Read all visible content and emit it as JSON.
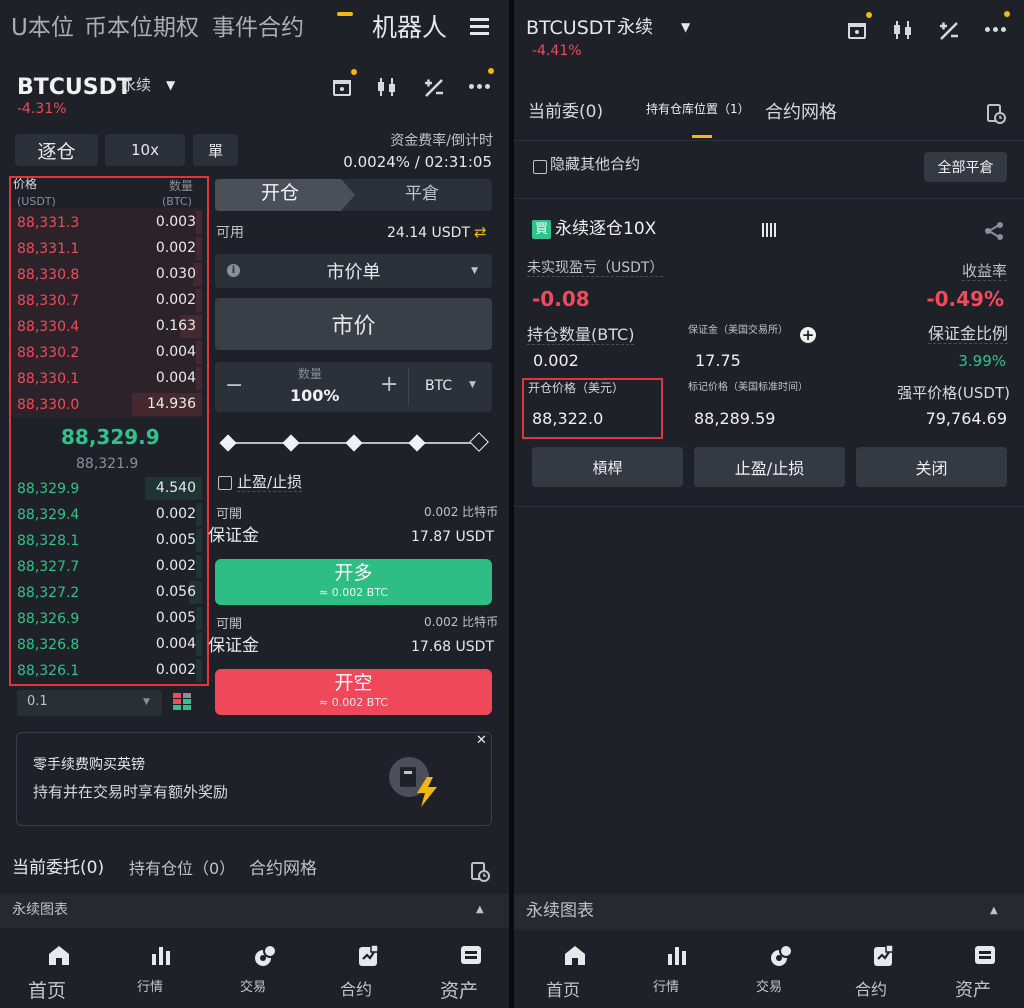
{
  "left": {
    "top_tabs": [
      "U本位",
      "币本位期权",
      "事件合约",
      "机器人"
    ],
    "symbol": "BTCUSDT",
    "contract_type": "永续",
    "change": "-4.31%",
    "margin_mode": "逐仓",
    "leverage": "10x",
    "position_mode": "單",
    "funding_label": "资金费率/倒计时",
    "funding_value": "0.0024% / 02:31:05",
    "ob_price_label": "价格",
    "ob_price_unit": "(USDT)",
    "ob_qty_label": "数量",
    "ob_qty_unit": "(BTC)",
    "asks": [
      {
        "price": "88,331.3",
        "qty": "0.003"
      },
      {
        "price": "88,331.1",
        "qty": "0.002"
      },
      {
        "price": "88,330.8",
        "qty": "0.030"
      },
      {
        "price": "88,330.7",
        "qty": "0.002"
      },
      {
        "price": "88,330.4",
        "qty": "0.163"
      },
      {
        "price": "88,330.2",
        "qty": "0.004"
      },
      {
        "price": "88,330.1",
        "qty": "0.004"
      },
      {
        "price": "88,330.0",
        "qty": "14.936"
      }
    ],
    "mid_price": "88,329.9",
    "mark_price": "88,321.9",
    "bids": [
      {
        "price": "88,329.9",
        "qty": "4.540"
      },
      {
        "price": "88,329.4",
        "qty": "0.002"
      },
      {
        "price": "88,328.1",
        "qty": "0.005"
      },
      {
        "price": "88,327.7",
        "qty": "0.002"
      },
      {
        "price": "88,327.2",
        "qty": "0.056"
      },
      {
        "price": "88,326.9",
        "qty": "0.005"
      },
      {
        "price": "88,326.8",
        "qty": "0.004"
      },
      {
        "price": "88,326.1",
        "qty": "0.002"
      }
    ],
    "depth_step": "0.1",
    "open_tab": "开仓",
    "close_tab": "平倉",
    "available_label": "可用",
    "available_value": "24.14 USDT",
    "order_type": "市价单",
    "price_field": "市价",
    "qty_label": "数量",
    "qty_value": "100%",
    "qty_unit": "BTC",
    "tpsl_label": "止盈/止损",
    "long_can_open_label": "可開",
    "long_can_open_value": "0.002 比特币",
    "long_margin_label": "保证金",
    "long_margin_value": "17.87 USDT",
    "long_button": "开多",
    "long_sub": "≈ 0.002 BTC",
    "short_can_open_label": "可開",
    "short_can_open_value": "0.002 比特币",
    "short_margin_label": "保证金",
    "short_margin_value": "17.68 USDT",
    "short_button": "开空",
    "short_sub": "≈ 0.002 BTC",
    "promo_title": "零手续费购买英镑",
    "promo_text": "持有并在交易时享有额外奖励",
    "bottom_tabs": [
      "当前委托(0)",
      "持有仓位（0）",
      "合约网格"
    ],
    "chart_bar_label": "永续图表"
  },
  "right": {
    "symbol": "BTCUSDT",
    "contract_type": "永续",
    "change": "-4.41%",
    "tabs": [
      {
        "label": "当前委(0)"
      },
      {
        "label": "持有仓库位置（1）"
      },
      {
        "label": "合约网格"
      }
    ],
    "hide_others_label": "隐藏其他合约",
    "close_all_button": "全部平倉",
    "position_badge": "買",
    "position_title": "永续逐仓10X",
    "unrealized_label": "未实现盈亏（USDT）",
    "unrealized_value": "-0.08",
    "roe_label": "收益率",
    "roe_value": "-0.49%",
    "size_label": "持仓数量(BTC)",
    "size_value": "0.002",
    "margin_label": "保证金（美国交易所）",
    "margin_value": "17.75",
    "margin_ratio_label": "保证金比例",
    "margin_ratio_value": "3.99%",
    "entry_label": "开仓价格（美元）",
    "entry_value": "88,322.0",
    "mark_label": "标记价格（美国标准时间）",
    "mark_value": "88,289.59",
    "liq_label": "强平价格(USDT)",
    "liq_value": "79,764.69",
    "actions": [
      "槓桿",
      "止盈/止损",
      "关闭"
    ],
    "chart_bar_label": "永续图表"
  },
  "nav": [
    "首页",
    "行情",
    "交易",
    "合约",
    "资产"
  ],
  "colors": {
    "up": "#2ec38b",
    "down": "#f04a5c",
    "accent": "#f0b90b",
    "highlight_box": "#e0343f"
  }
}
